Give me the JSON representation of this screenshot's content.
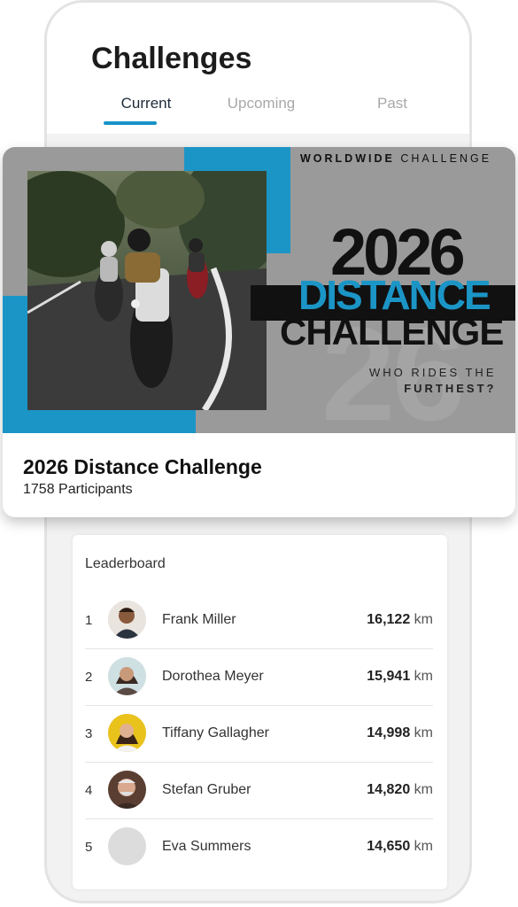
{
  "screen": {
    "title": "Challenges"
  },
  "tabs": [
    {
      "label": "Current",
      "active": true
    },
    {
      "label": "Upcoming",
      "active": false
    },
    {
      "label": "Past",
      "active": false
    }
  ],
  "colors": {
    "accent": "#1b95c6",
    "banner_bg": "#9a9a9a",
    "text_dark": "#111111"
  },
  "challenge": {
    "banner": {
      "tag_bold": "WORLDWIDE",
      "tag_rest": "CHALLENGE",
      "year": "2026",
      "word1": "DISTANCE",
      "word2": "CHALLENGE",
      "tagline_line1": "WHO RIDES THE",
      "tagline_line2": "FURTHEST?",
      "watermark": "26"
    },
    "title": "2026 Distance Challenge",
    "participants": "1758 Participants"
  },
  "leaderboard": {
    "title": "Leaderboard",
    "unit": "km",
    "rows": [
      {
        "rank": "1",
        "name": "Frank Miller",
        "distance": "16,122"
      },
      {
        "rank": "2",
        "name": "Dorothea Meyer",
        "distance": "15,941"
      },
      {
        "rank": "3",
        "name": "Tiffany Gallagher",
        "distance": "14,998"
      },
      {
        "rank": "4",
        "name": "Stefan Gruber",
        "distance": "14,820"
      },
      {
        "rank": "5",
        "name": "Eva Summers",
        "distance": "14,650"
      }
    ]
  }
}
